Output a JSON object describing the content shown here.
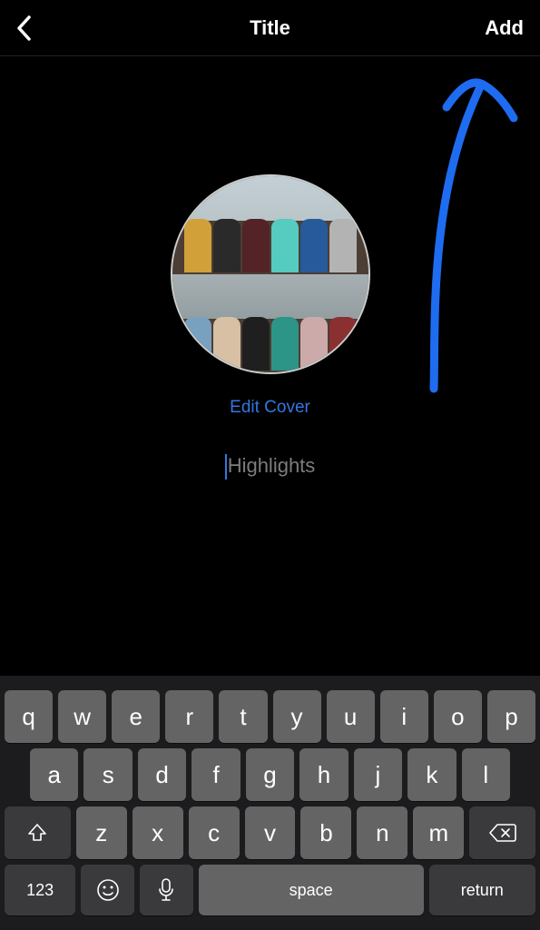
{
  "header": {
    "title": "Title",
    "add_label": "Add"
  },
  "cover": {
    "edit_label": "Edit Cover"
  },
  "input": {
    "placeholder": "Highlights",
    "value": ""
  },
  "keyboard": {
    "row1": [
      "q",
      "w",
      "e",
      "r",
      "t",
      "y",
      "u",
      "i",
      "o",
      "p"
    ],
    "row2": [
      "a",
      "s",
      "d",
      "f",
      "g",
      "h",
      "j",
      "k",
      "l"
    ],
    "row3": [
      "z",
      "x",
      "c",
      "v",
      "b",
      "n",
      "m"
    ],
    "numbers_label": "123",
    "space_label": "space",
    "return_label": "return"
  },
  "annotation": {
    "arrow_color": "#1e6cf0"
  }
}
